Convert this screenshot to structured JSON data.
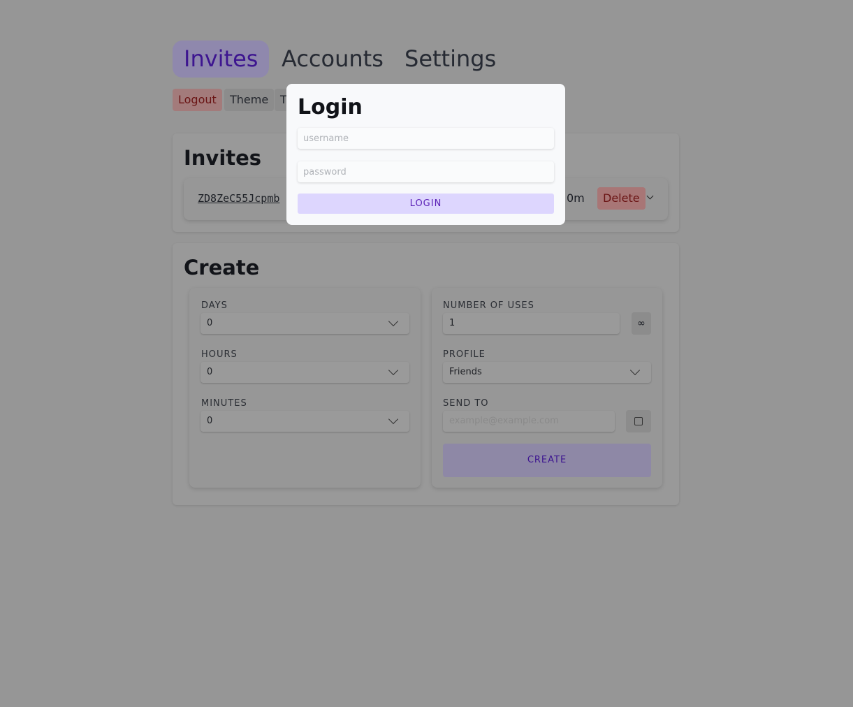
{
  "nav": {
    "tabs": [
      {
        "label": "Invites",
        "active": true
      },
      {
        "label": "Accounts"
      },
      {
        "label": "Settings"
      }
    ]
  },
  "toolbar": {
    "logout": "Logout",
    "theme": "Theme",
    "third": "T"
  },
  "invites": {
    "title": "Invites",
    "code": "ZD8ZeC55Jcpmb",
    "remaining": "0m",
    "delete": "Delete"
  },
  "create": {
    "title": "Create",
    "days": {
      "label": "DAYS",
      "value": "0"
    },
    "hours": {
      "label": "HOURS",
      "value": "0"
    },
    "minutes": {
      "label": "MINUTES",
      "value": "0"
    },
    "uses": {
      "label": "NUMBER OF USES",
      "value": "1",
      "infinity": "∞"
    },
    "profile": {
      "label": "PROFILE",
      "value": "Friends"
    },
    "send_to": {
      "label": "SEND TO",
      "placeholder": "example@example.com"
    },
    "button": "CREATE"
  },
  "login": {
    "title": "Login",
    "username_placeholder": "username",
    "password_placeholder": "password",
    "button": "LOGIN"
  },
  "colors": {
    "accent": "#3d1590",
    "login_button": "#ddd6fe",
    "delete": "#a87676"
  }
}
